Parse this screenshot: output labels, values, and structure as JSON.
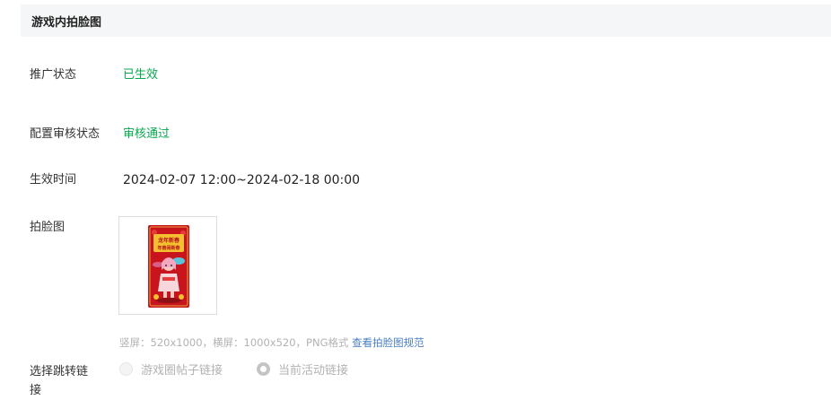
{
  "section": {
    "title": "游戏内拍脸图"
  },
  "rows": {
    "promo_status": {
      "label": "推广状态",
      "value": "已生效"
    },
    "review_status": {
      "label": "配置审核状态",
      "value": "审核通过"
    },
    "effective_time": {
      "label": "生效时间",
      "value": "2024-02-07 12:00~2024-02-18 00:00"
    },
    "face_image": {
      "label": "拍脸图"
    }
  },
  "image_hint": {
    "text": "竖屏：520x1000，横屏：1000x520，PNG格式 ",
    "link": "查看拍脸图规范"
  },
  "jump_link": {
    "label": "选择跳转链接",
    "options": [
      {
        "label": "游戏圈帖子链接",
        "selected": false
      },
      {
        "label": "当前活动链接",
        "selected": true
      }
    ]
  },
  "colors": {
    "status_green": "#07a84f",
    "link_blue": "#4a7fc1",
    "header_bg": "#f5f6f7",
    "poster_red": "#c8141c"
  },
  "poster": {
    "banner_line1": "龙年新春",
    "banner_line2": "年兽闹新春"
  }
}
